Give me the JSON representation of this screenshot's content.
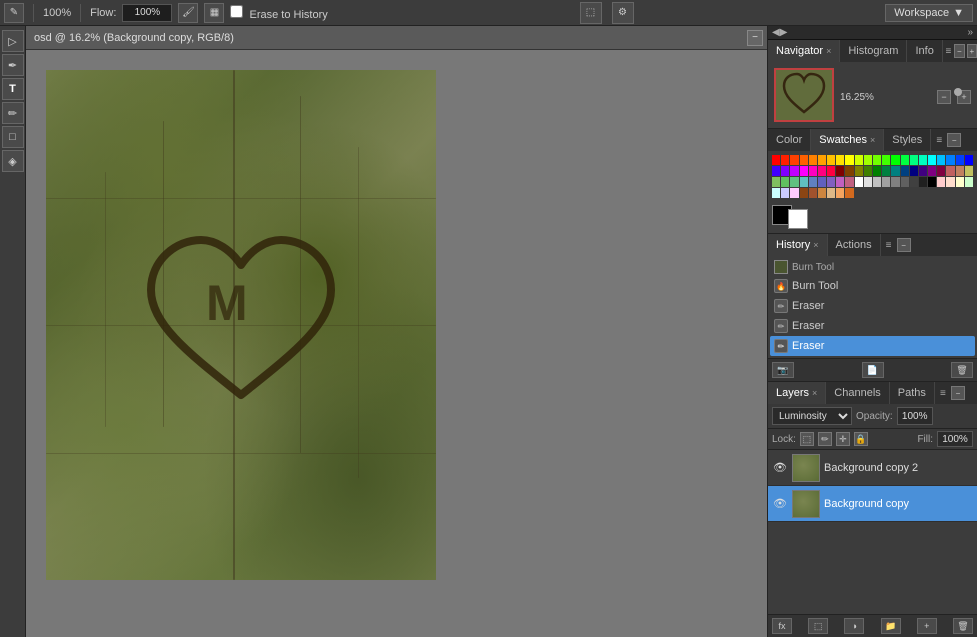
{
  "toolbar": {
    "flow_label": "Flow:",
    "flow_value": "100%",
    "opacity_value": "100%",
    "erase_to_history_label": "Erase to History",
    "workspace_label": "Workspace"
  },
  "canvas": {
    "title": "osd @ 16.2% (Background copy, RGB/8)"
  },
  "navigator": {
    "panel_label": "Navigator",
    "histogram_label": "Histogram",
    "info_label": "Info",
    "zoom_value": "16.25%"
  },
  "color_panel": {
    "color_tab": "Color",
    "swatches_tab": "Swatches",
    "styles_tab": "Styles"
  },
  "history": {
    "tab_label": "History",
    "actions_tab": "Actions",
    "items": [
      {
        "name": "Burn Tool",
        "icon": "🔥"
      },
      {
        "name": "Eraser",
        "icon": "✏"
      },
      {
        "name": "Eraser",
        "icon": "✏"
      },
      {
        "name": "Eraser",
        "icon": "✏",
        "active": true
      }
    ]
  },
  "layers": {
    "tab_label": "Layers",
    "channels_tab": "Channels",
    "paths_tab": "Paths",
    "blend_mode": "Luminosity",
    "opacity_label": "Opacity:",
    "opacity_value": "100%",
    "lock_label": "Lock:",
    "fill_label": "Fill:",
    "fill_value": "100%",
    "items": [
      {
        "name": "Background copy 2",
        "active": false
      },
      {
        "name": "Background copy",
        "active": true
      }
    ]
  },
  "swatches": {
    "colors": [
      "#ff0000",
      "#ff2000",
      "#ff4000",
      "#ff6000",
      "#ff8000",
      "#ffa000",
      "#ffc000",
      "#ffe000",
      "#ffff00",
      "#d0ff00",
      "#a0ff00",
      "#70ff00",
      "#40ff00",
      "#00ff00",
      "#00ff40",
      "#00ff80",
      "#00ffc0",
      "#00ffff",
      "#00c0ff",
      "#0080ff",
      "#0040ff",
      "#0000ff",
      "#4000ff",
      "#8000ff",
      "#c000ff",
      "#ff00ff",
      "#ff00c0",
      "#ff0080",
      "#ff0040",
      "#800000",
      "#804000",
      "#808000",
      "#408000",
      "#008000",
      "#008040",
      "#008080",
      "#004080",
      "#000080",
      "#400080",
      "#800080",
      "#800040",
      "#c06060",
      "#c08060",
      "#c0c060",
      "#80c060",
      "#60c060",
      "#60c080",
      "#60c0c0",
      "#6080c0",
      "#6060c0",
      "#8060c0",
      "#c060c0",
      "#c06080",
      "#ffffff",
      "#e0e0e0",
      "#c0c0c0",
      "#a0a0a0",
      "#808080",
      "#606060",
      "#404040",
      "#202020",
      "#000000",
      "#ffcccc",
      "#ffddcc",
      "#ffffcc",
      "#ccffcc",
      "#ccffff",
      "#ccccff",
      "#ffccff",
      "#8b4513",
      "#a0522d",
      "#cd853f",
      "#deb887",
      "#f4a460",
      "#d2691e"
    ]
  }
}
